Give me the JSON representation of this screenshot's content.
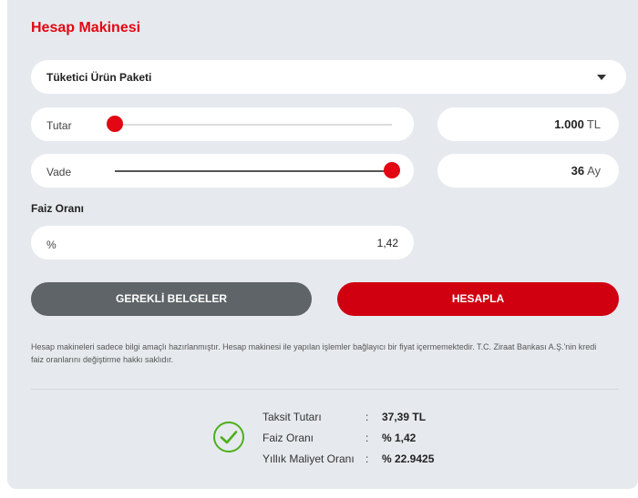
{
  "title": "Hesap Makinesi",
  "product": {
    "selected": "Tüketici Ürün Paketi"
  },
  "amount": {
    "label": "Tutar",
    "value": "1.000",
    "unit": "TL",
    "slider_fraction": 0.0
  },
  "term": {
    "label": "Vade",
    "value": "36",
    "unit": "Ay",
    "slider_fraction": 1.0
  },
  "interest": {
    "section_label": "Faiz Oranı",
    "symbol": "%",
    "value": "1,42"
  },
  "buttons": {
    "documents": "GEREKLİ BELGELER",
    "calculate": "HESAPLA"
  },
  "disclaimer": "Hesap makineleri sadece bilgi amaçlı hazırlanmıştır. Hesap makinesi ile yapılan işlemler bağlayıcı bir fiyat içermemektedir. T.C. Ziraat Bankası A.Ş.'nin kredi faiz oranlarını değiştirme hakkı saklıdır.",
  "results": [
    {
      "label": "Taksit Tutarı",
      "value": "37,39 TL"
    },
    {
      "label": "Faiz Oranı",
      "value": "% 1,42"
    },
    {
      "label": "Yıllık Maliyet Oranı",
      "value": "% 22.9425"
    }
  ],
  "colors": {
    "accent": "#e30613",
    "button_dark": "#5e6467",
    "button_red": "#d00010",
    "success": "#4caf1a"
  },
  "icons": {
    "result": "check-circle-icon",
    "dropdown": "chevron-down-icon"
  }
}
